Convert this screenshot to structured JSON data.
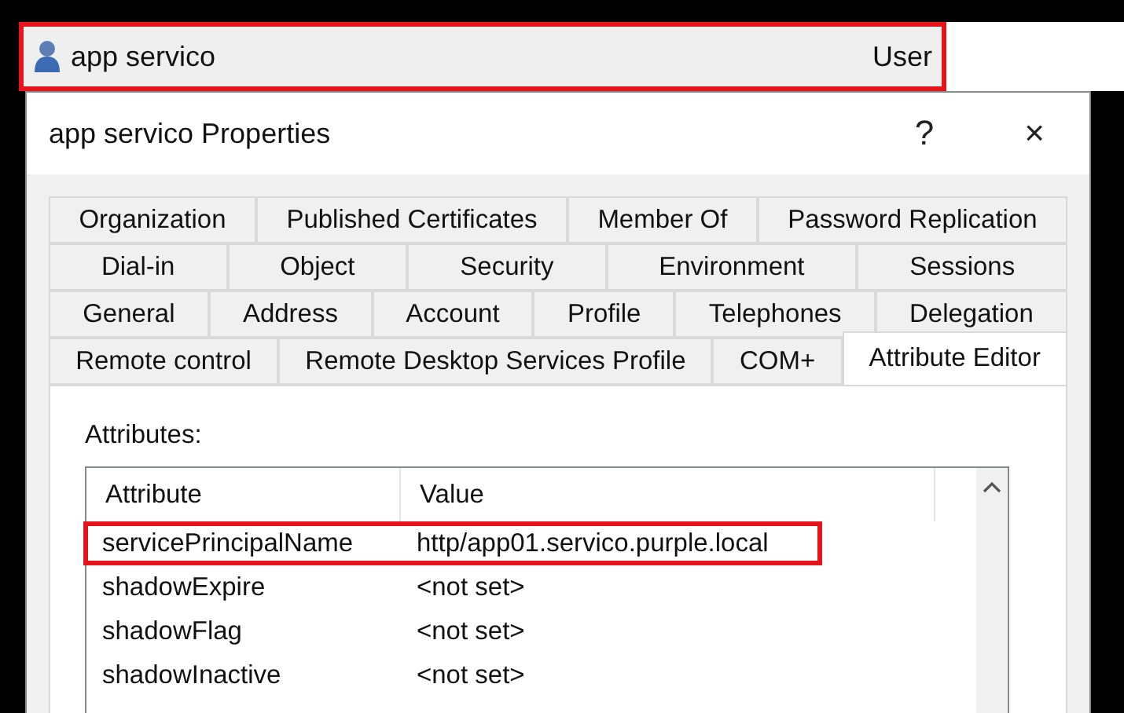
{
  "list_item": {
    "name": "app servico",
    "type": "User",
    "highlighted": true
  },
  "dialog": {
    "title": "app servico Properties",
    "help": "?",
    "close": "×"
  },
  "tab_rows": [
    {
      "tabs": [
        {
          "label": "Organization",
          "selected": false
        },
        {
          "label": "Published Certificates",
          "selected": false
        },
        {
          "label": "Member Of",
          "selected": false
        },
        {
          "label": "Password Replication",
          "selected": false
        }
      ]
    },
    {
      "tabs": [
        {
          "label": "Dial-in",
          "selected": false
        },
        {
          "label": "Object",
          "selected": false
        },
        {
          "label": "Security",
          "selected": false
        },
        {
          "label": "Environment",
          "selected": false
        },
        {
          "label": "Sessions",
          "selected": false
        }
      ]
    },
    {
      "tabs": [
        {
          "label": "General",
          "selected": false
        },
        {
          "label": "Address",
          "selected": false
        },
        {
          "label": "Account",
          "selected": false
        },
        {
          "label": "Profile",
          "selected": false
        },
        {
          "label": "Telephones",
          "selected": false
        },
        {
          "label": "Delegation",
          "selected": false
        }
      ]
    },
    {
      "tabs": [
        {
          "label": "Remote control",
          "selected": false
        },
        {
          "label": "Remote Desktop Services Profile",
          "selected": false
        },
        {
          "label": "COM+",
          "selected": false
        },
        {
          "label": "Attribute Editor",
          "selected": true
        }
      ]
    }
  ],
  "attributes": {
    "label": "Attributes:",
    "columns": [
      "Attribute",
      "Value"
    ],
    "rows": [
      {
        "attribute": "servicePrincipalName",
        "value": "http/app01.servico.purple.local",
        "highlighted": true
      },
      {
        "attribute": "shadowExpire",
        "value": "<not set>",
        "highlighted": false
      },
      {
        "attribute": "shadowFlag",
        "value": "<not set>",
        "highlighted": false
      },
      {
        "attribute": "shadowInactive",
        "value": "<not set>",
        "highlighted": false
      }
    ]
  }
}
